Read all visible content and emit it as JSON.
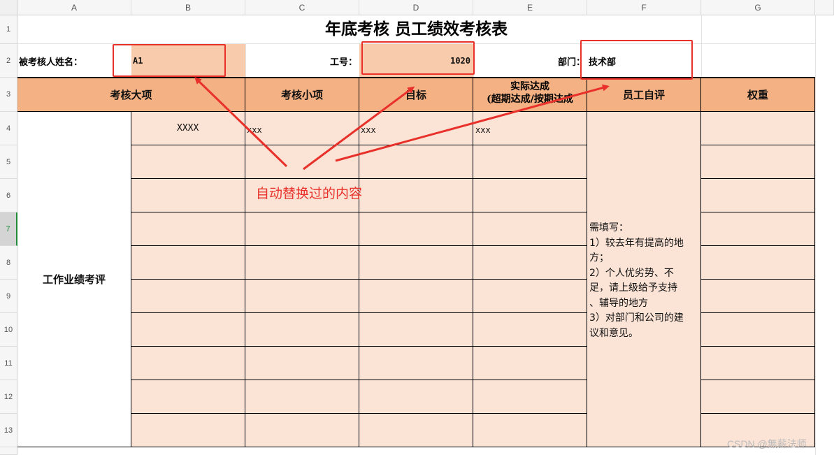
{
  "columns": [
    "A",
    "B",
    "C",
    "D",
    "E",
    "F",
    "G"
  ],
  "rows": [
    "1",
    "2",
    "3",
    "4",
    "5",
    "6",
    "7",
    "8",
    "9",
    "10",
    "11",
    "12",
    "13"
  ],
  "selected_row": "7",
  "sheet": {
    "title": "年底考核  员工绩效考核表",
    "name_label": "被考核人姓名：",
    "name_value": "A1",
    "id_label": "工号：",
    "id_value": "1020",
    "dept_label": "部门：",
    "dept_value": "技术部",
    "headers": {
      "major": "考核大项",
      "minor": "考核小项",
      "target": "目标",
      "actual_line1": "实际达成",
      "actual_line2": "(超期达成/按期达成",
      "self_eval": "员工自评",
      "weight": "权重"
    },
    "category": "工作业绩考评",
    "row4": {
      "b": "XXXX",
      "c": "xxx",
      "d": "xxx",
      "e": "xxx"
    },
    "self_eval_note": [
      "需填写：",
      "1）较去年有提高的地",
      "方；",
      "2）个人优劣势、不",
      "足，请上级给予支持",
      "、辅导的地方",
      "3）对部门和公司的建",
      "议和意见。"
    ]
  },
  "annotation": "自动替换过的内容",
  "watermark": "CSDN @無薪法师",
  "colors": {
    "accent_red": "#e8312a",
    "header_band": "#f4b183",
    "peach_light": "#fbe3d6",
    "peach_mid": "#f8cbad"
  }
}
